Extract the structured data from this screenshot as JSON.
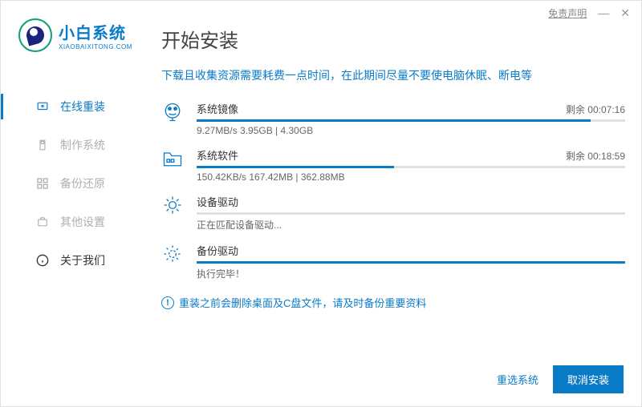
{
  "titlebar": {
    "disclaimer": "免责声明"
  },
  "logo": {
    "name": "小白系统",
    "sub": "XIAOBAIXITONG.COM"
  },
  "nav": {
    "items": [
      {
        "label": "在线重装",
        "active": true
      },
      {
        "label": "制作系统"
      },
      {
        "label": "备份还原"
      },
      {
        "label": "其他设置"
      },
      {
        "label": "关于我们",
        "dark": true
      }
    ]
  },
  "main": {
    "title": "开始安装",
    "notice": "下载且收集资源需要耗费一点时间，在此期间尽量不要使电脑休眠、断电等"
  },
  "tasks": [
    {
      "title": "系统镜像",
      "detail": "9.27MB/s 3.95GB | 4.30GB",
      "remain": "剩余 00:07:16",
      "pct": 92
    },
    {
      "title": "系统软件",
      "detail": "150.42KB/s 167.42MB | 362.88MB",
      "remain": "剩余 00:18:59",
      "pct": 46
    },
    {
      "title": "设备驱动",
      "detail": "正在匹配设备驱动...",
      "remain": "",
      "pct": 0
    },
    {
      "title": "备份驱动",
      "detail": "执行完毕！",
      "remain": "",
      "pct": 100
    }
  ],
  "warning": "重装之前会删除桌面及C盘文件，请及时备份重要资料",
  "footer": {
    "reselect": "重选系统",
    "cancel": "取消安装"
  }
}
